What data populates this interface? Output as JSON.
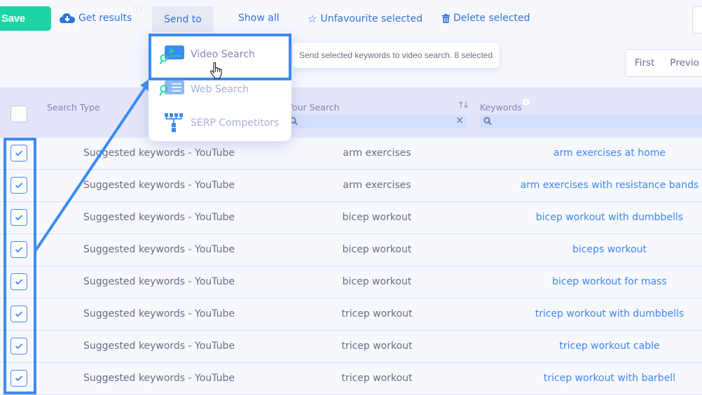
{
  "toolbar": {
    "save_label": "Save",
    "get_results_label": "Get results",
    "get_results_icon": "cloud-download-icon",
    "info_icon": "i",
    "send_to_label": "Send to",
    "show_all_label": "Show all",
    "unfavourite_label": "Unfavourite selected",
    "unfavourite_icon": "☆",
    "delete_label": "Delete selected",
    "delete_icon": "trash-icon"
  },
  "pagination": {
    "first_label": "First",
    "previous_label": "Previo"
  },
  "dropdown": {
    "items": [
      {
        "label": "Video Search",
        "icon": "video-search-icon",
        "highlighted": true
      },
      {
        "label": "Web Search",
        "icon": "web-search-icon",
        "highlighted": false
      },
      {
        "label": "SERP Competitors",
        "icon": "serp-competitors-icon",
        "highlighted": false
      }
    ],
    "tooltip": "Send selected keywords to video search. 8 selected"
  },
  "table": {
    "columns": {
      "search_type": "Search Type",
      "your_search": "Your Search",
      "keywords": "Keywords",
      "keywords_info": "i"
    },
    "rows": [
      {
        "checked": true,
        "search_type": "Suggested keywords - YouTube",
        "your_search": "arm exercises",
        "keyword": "arm exercises at home"
      },
      {
        "checked": true,
        "search_type": "Suggested keywords - YouTube",
        "your_search": "arm exercises",
        "keyword": "arm exercises with resistance bands"
      },
      {
        "checked": true,
        "search_type": "Suggested keywords - YouTube",
        "your_search": "bicep workout",
        "keyword": "bicep workout with dumbbells"
      },
      {
        "checked": true,
        "search_type": "Suggested keywords - YouTube",
        "your_search": "bicep workout",
        "keyword": "biceps workout"
      },
      {
        "checked": true,
        "search_type": "Suggested keywords - YouTube",
        "your_search": "bicep workout",
        "keyword": "bicep workout for mass"
      },
      {
        "checked": true,
        "search_type": "Suggested keywords - YouTube",
        "your_search": "tricep workout",
        "keyword": "tricep workout with dumbbells"
      },
      {
        "checked": true,
        "search_type": "Suggested keywords - YouTube",
        "your_search": "tricep workout",
        "keyword": "tricep workout cable"
      },
      {
        "checked": true,
        "search_type": "Suggested keywords - YouTube",
        "your_search": "tricep workout",
        "keyword": "tricep workout with barbell"
      }
    ]
  },
  "colors": {
    "save_green": "#1ed4a4",
    "link_blue": "#2e74d9",
    "keyword_blue": "#3d86f2",
    "annotation_blue": "#3d8bf2",
    "header_bg": "#e3e6fb",
    "teal_accent": "#1fd3a0"
  }
}
